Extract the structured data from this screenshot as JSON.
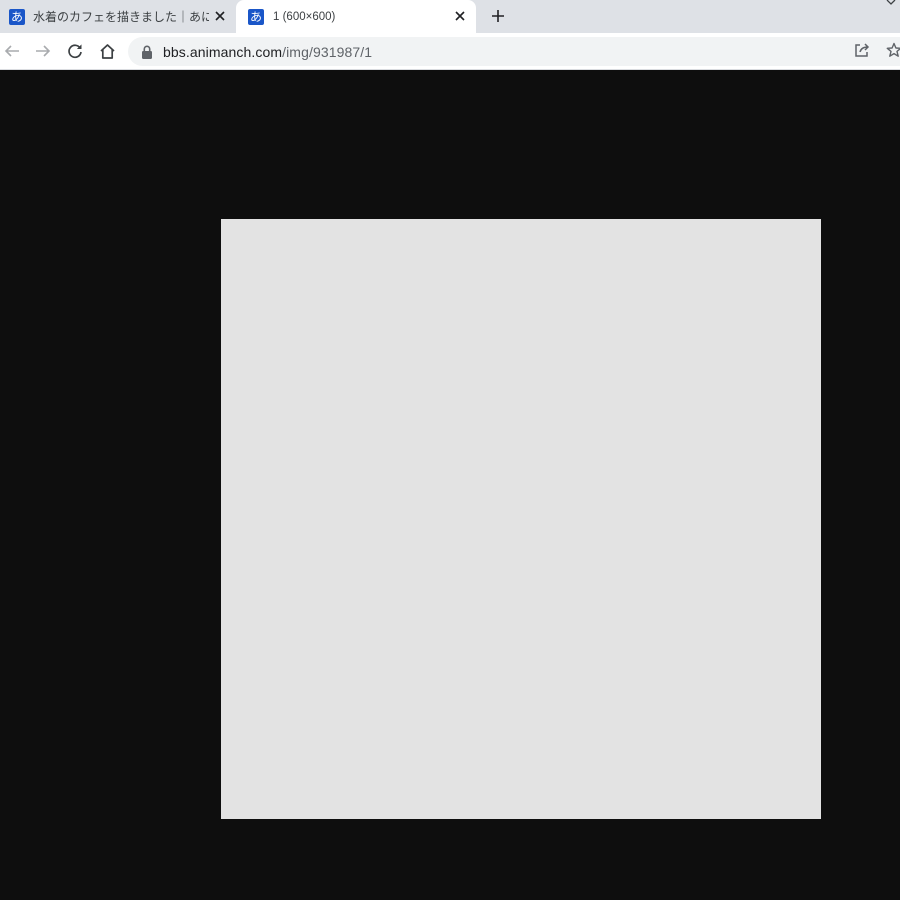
{
  "tabs": [
    {
      "favicon_glyph": "あ",
      "title": "水着のカフェを描きました｜あにまん掲",
      "active": false
    },
    {
      "favicon_glyph": "あ",
      "title": "1 (600×600)",
      "active": true
    }
  ],
  "address_bar": {
    "host": "bbs.animanch.com",
    "path": "/img/931987/1"
  },
  "icons": {
    "back": "arrow-left-icon",
    "forward": "arrow-right-icon",
    "reload": "reload-icon",
    "home": "home-icon",
    "lock": "lock-icon",
    "share": "share-icon",
    "bookmark": "star-icon",
    "close": "close-icon",
    "new_tab": "plus-icon"
  },
  "colors": {
    "tabstrip": "#dee1e6",
    "page_background": "#0e0e0e",
    "image_placeholder": "#e3e3e3",
    "favicon": "#1a56c8"
  }
}
